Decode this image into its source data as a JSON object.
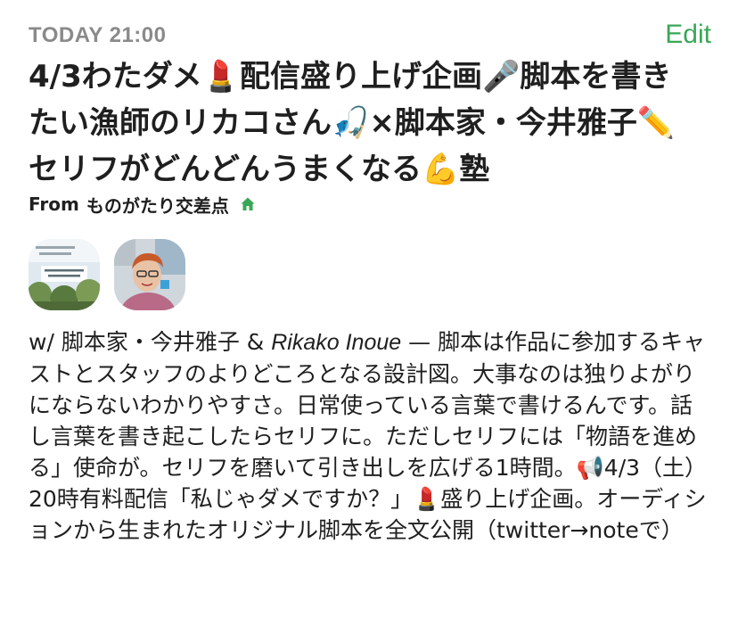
{
  "header": {
    "timestamp": "TODAY 21:00",
    "edit_label": "Edit"
  },
  "event": {
    "title": "4/3わたダメ💄配信盛り上げ企画🎤脚本を書きたい漁師のリカコさん🎣×脚本家・今井雅子✏️セリフがどんどんうまくなる💪塾",
    "from_prefix": "From",
    "club_name": "ものがたり交差点",
    "club_icon": "house-icon"
  },
  "hosts": {
    "prefix": "w/ ",
    "host1": "脚本家・今井雅子",
    "joiner": " & ",
    "host2": "Rikako Inoue",
    "dash": " — "
  },
  "description": "脚本は作品に参加するキャストとスタッフのよりどころとなる設計図。大事なのは独りよがりにならないわかりやすさ。日常使っている言葉で書けるんです。話し言葉を書き起こしたらセリフに。ただしセリフには「物語を進める」使命が。セリフを磨いて引き出しを広げる1時間。📢4/3（土）20時有料配信「私じゃダメですか？」💄盛り上げ企画。オーディションから生まれたオリジナル脚本を全文公開（twitter→noteで）",
  "colors": {
    "accent_green": "#3aa757",
    "timestamp_gray": "#8a8a8a",
    "text": "#1f1f1f"
  }
}
